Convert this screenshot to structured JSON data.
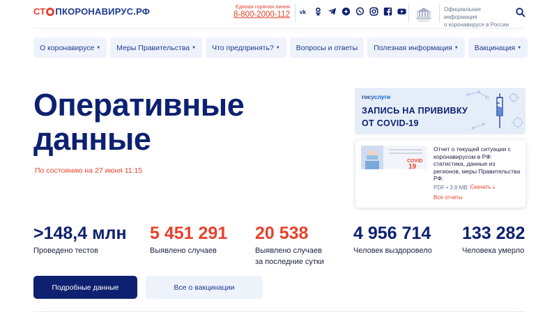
{
  "header": {
    "logo_prefix": "СТ",
    "logo_suffix": "ПКОРОНАВИРУС.РФ",
    "hotline_label": "Единая горячая линия",
    "hotline_number": "8-800-2000-112",
    "social_icons": [
      "vk-icon",
      "odnoklassniki-icon",
      "telegram-icon",
      "yandex-zen-icon",
      "viber-icon",
      "instagram-icon",
      "facebook-icon",
      "youtube-icon"
    ],
    "gov_info_line1": "Официальная информация",
    "gov_info_line2": "о коронавирусе в России"
  },
  "nav": [
    {
      "label": "О коронавирусе",
      "dropdown": true
    },
    {
      "label": "Меры Правительства",
      "dropdown": true
    },
    {
      "label": "Что предпринять?",
      "dropdown": true
    },
    {
      "label": "Вопросы и ответы",
      "dropdown": false
    },
    {
      "label": "Полезная информация",
      "dropdown": true
    },
    {
      "label": "Вакцинация",
      "dropdown": true
    }
  ],
  "hero": {
    "title_line1": "Оперативные",
    "title_line2": "данные",
    "date": "По состоянию на 27 июня 11:15"
  },
  "banner": {
    "brand_a": "гос",
    "brand_b": "услуги",
    "line1": "ЗАПИСЬ НА ПРИВИВКУ",
    "line2": "ОТ COVID-19"
  },
  "report": {
    "thumb_text": "COVID",
    "thumb_number": "19",
    "description": "Отчет о текущей ситуации с коронавирусом в РФ: статистика, данные из регионов, меры Правительства РФ.",
    "file_info": "PDF • 3.8 MB",
    "download_label": "Скачать",
    "all_reports": "Все отчеты"
  },
  "stats": [
    {
      "value": ">148,4 млн",
      "label": "Проведено тестов",
      "color": "#0d2170"
    },
    {
      "value": "5 451 291",
      "label": "Выявлено случаев",
      "color": "#e8412c"
    },
    {
      "value": "20 538",
      "label": "Выявлено случаев за последние сутки",
      "color": "#e8412c"
    },
    {
      "value": "4 956 714",
      "label": "Человек выздоровело",
      "color": "#0d2170"
    },
    {
      "value": "133 282",
      "label": "Человека умерло",
      "color": "#0d2170"
    }
  ],
  "buttons": {
    "details": "Подробные данные",
    "vaccination": "Все о вакцинации"
  },
  "colors": {
    "brand_navy": "#0d2170",
    "accent_red": "#e8412c",
    "nav_bg": "#eef2fb"
  }
}
